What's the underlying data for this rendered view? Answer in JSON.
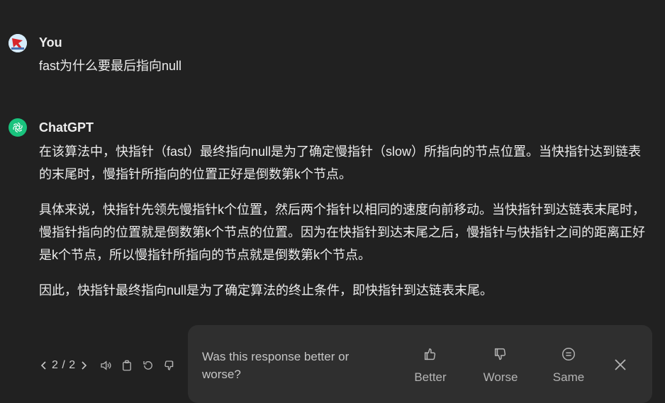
{
  "user": {
    "name": "You",
    "message": "fast为什么要最后指向null"
  },
  "assistant": {
    "name": "ChatGPT",
    "paragraphs": [
      "在该算法中，快指针（fast）最终指向null是为了确定慢指针（slow）所指向的节点位置。当快指针达到链表的末尾时，慢指针所指向的位置正好是倒数第k个节点。",
      "具体来说，快指针先领先慢指针k个位置，然后两个指针以相同的速度向前移动。当快指针到达链表末尾时，慢指针指向的位置就是倒数第k个节点的位置。因为在快指针到达末尾之后，慢指针与快指针之间的距离正好是k个节点，所以慢指针所指向的节点就是倒数第k个节点。",
      "因此，快指针最终指向null是为了确定算法的终止条件，即快指针到达链表末尾。"
    ]
  },
  "toolbar": {
    "pager": "2 / 2",
    "icons": [
      "chevron-left-icon",
      "chevron-right-icon",
      "speaker-icon",
      "copy-icon",
      "regenerate-icon",
      "thumbs-down-icon"
    ]
  },
  "feedback": {
    "question": "Was this response better or worse?",
    "better_label": "Better",
    "worse_label": "Worse",
    "same_label": "Same"
  },
  "colors": {
    "background": "#212121",
    "panel": "#2f2f2f",
    "text": "#ececec",
    "muted": "#b4b4b4",
    "gpt_green": "#19c37d"
  }
}
